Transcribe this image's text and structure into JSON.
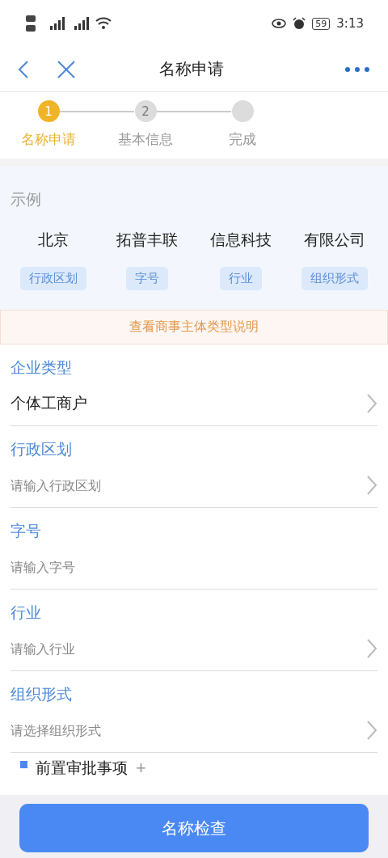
{
  "status_bar": {
    "battery": "59",
    "time": "3:13"
  },
  "header": {
    "title": "名称申请"
  },
  "steps": [
    {
      "number": "1",
      "label": "名称申请",
      "selected": true
    },
    {
      "number": "2",
      "label": "基本信息",
      "selected": false
    },
    {
      "label": "完成",
      "selected": false
    }
  ],
  "example": {
    "title": "示例",
    "parts": [
      {
        "text": "北京",
        "tag": "行政区划"
      },
      {
        "text": "拓普丰联",
        "tag": "字号"
      },
      {
        "text": "信息科技",
        "tag": "行业"
      },
      {
        "text": "有限公司",
        "tag": "组织形式"
      }
    ]
  },
  "notice_link": "查看商事主体类型说明",
  "fields": [
    {
      "label": "企业类型",
      "kind": "select",
      "value": "个体工商户"
    },
    {
      "label": "行政区划",
      "kind": "select",
      "placeholder": "请输入行政区划"
    },
    {
      "label": "字号",
      "kind": "input",
      "placeholder": "请输入字号"
    },
    {
      "label": "行业",
      "kind": "select",
      "placeholder": "请输入行业"
    },
    {
      "label": "组织形式",
      "kind": "select",
      "placeholder": "请选择组织形式"
    }
  ],
  "section": {
    "title": "前置审批事项",
    "add": "+"
  },
  "submit": "名称检查"
}
